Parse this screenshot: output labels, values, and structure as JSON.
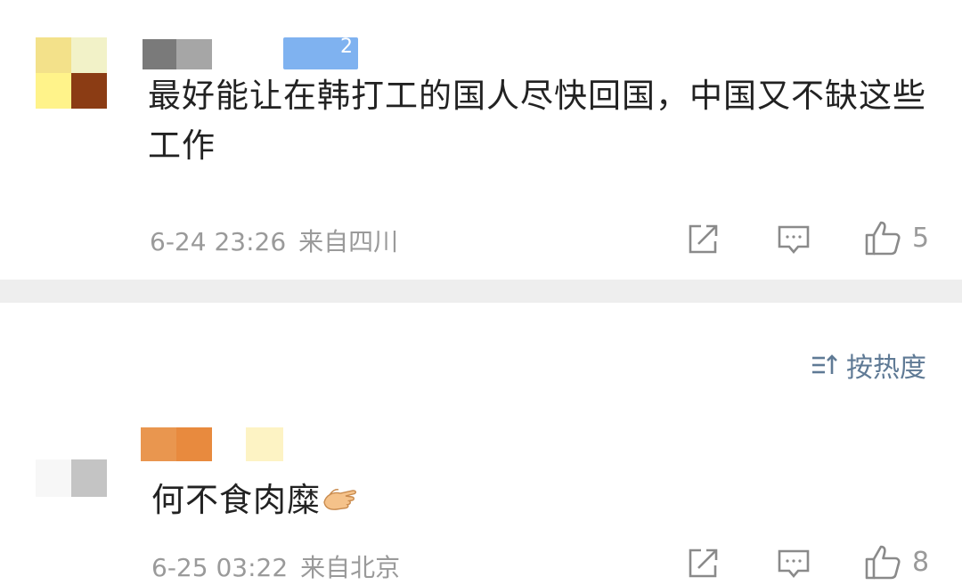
{
  "comments": [
    {
      "text": "最好能让在韩打工的国人尽快回国，中国又不缺这些工作",
      "time": "6-24 23:26",
      "location": "来自四川",
      "likes": "5"
    },
    {
      "text": "何不食肉糜",
      "time": "6-25 03:22",
      "location": "来自北京",
      "likes": "8"
    }
  ],
  "comment1_badge": "2",
  "sort": {
    "label": "按热度"
  },
  "icons": {
    "share": "share-icon",
    "reply": "comment-icon",
    "like": "thumbs-up-icon",
    "sort": "sort-icon",
    "emoji": "hand-emoji-icon"
  },
  "colors": {
    "text": "#222222",
    "meta": "#9a9a9a",
    "accent": "#5f7a95",
    "divider": "#eeeeee"
  }
}
